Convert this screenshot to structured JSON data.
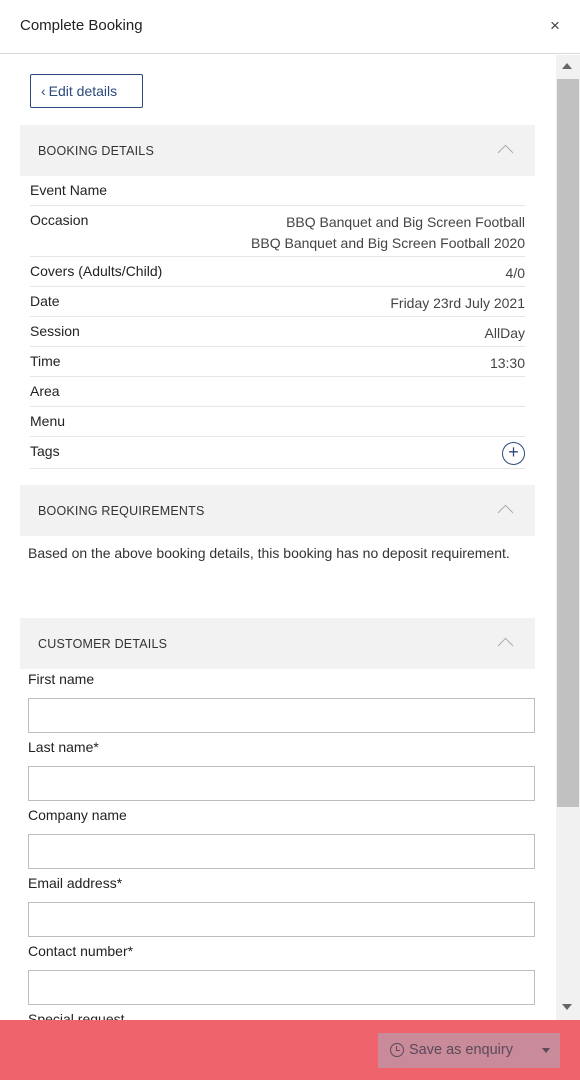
{
  "header": {
    "title": "Complete Booking",
    "close_glyph": "×"
  },
  "edit_button": {
    "label": "Edit details",
    "chevron": "‹"
  },
  "booking_details": {
    "title": "BOOKING DETAILS",
    "rows": [
      {
        "label": "Event Name",
        "value": ""
      },
      {
        "label": "Occasion",
        "value_lines": [
          "BBQ Banquet and Big Screen Football",
          "BBQ Banquet and Big Screen Football 2020"
        ]
      },
      {
        "label": "Covers (Adults/Child)",
        "value": "4/0"
      },
      {
        "label": "Date",
        "value": "Friday 23rd July 2021"
      },
      {
        "label": "Session",
        "value": "AllDay"
      },
      {
        "label": "Time",
        "value": "13:30"
      },
      {
        "label": "Area",
        "value": ""
      },
      {
        "label": "Menu",
        "value": ""
      },
      {
        "label": "Tags",
        "value": ""
      }
    ],
    "add_tag_glyph": "+"
  },
  "booking_requirements": {
    "title": "BOOKING REQUIREMENTS",
    "text": "Based on the above booking details, this booking has no deposit requirement."
  },
  "customer_details": {
    "title": "CUSTOMER DETAILS",
    "fields": [
      {
        "label": "First name",
        "value": ""
      },
      {
        "label": "Last name*",
        "value": ""
      },
      {
        "label": "Company name",
        "value": ""
      },
      {
        "label": "Email address*",
        "value": ""
      },
      {
        "label": "Contact number*",
        "value": ""
      },
      {
        "label": "Special request"
      }
    ]
  },
  "footer": {
    "save_label": "Save as enquiry",
    "color": "#ee636c"
  }
}
